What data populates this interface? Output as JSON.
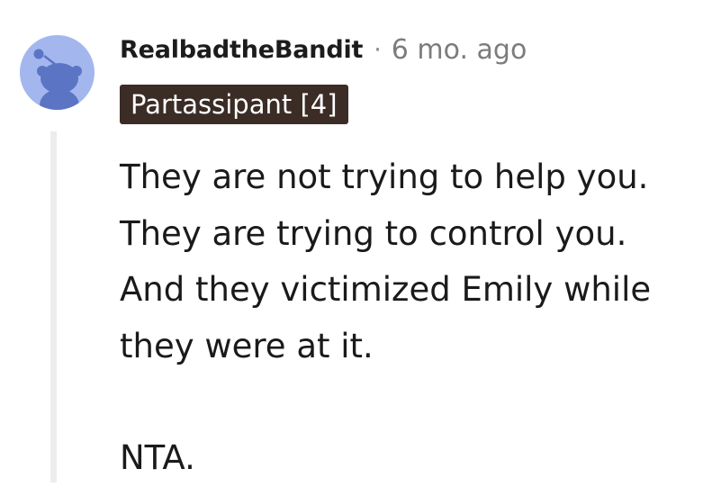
{
  "comment": {
    "author": "RealbadtheBandit",
    "separator": "·",
    "timestamp": "6 mo. ago",
    "flair": "Partassipant [4]",
    "avatar_icon": "reddit-snoo-avatar-icon",
    "body_lines": [
      "They are not trying to help you.",
      "They are trying to control you.",
      "And they victimized Emily while",
      "they were at it.",
      "NTA."
    ]
  },
  "colors": {
    "avatar_bg": "#a3b7ee",
    "snoo": "#5b74c4",
    "flair_bg": "#3b2c26",
    "thread_line": "#ededed",
    "meta_gray": "#7c7c7c"
  }
}
